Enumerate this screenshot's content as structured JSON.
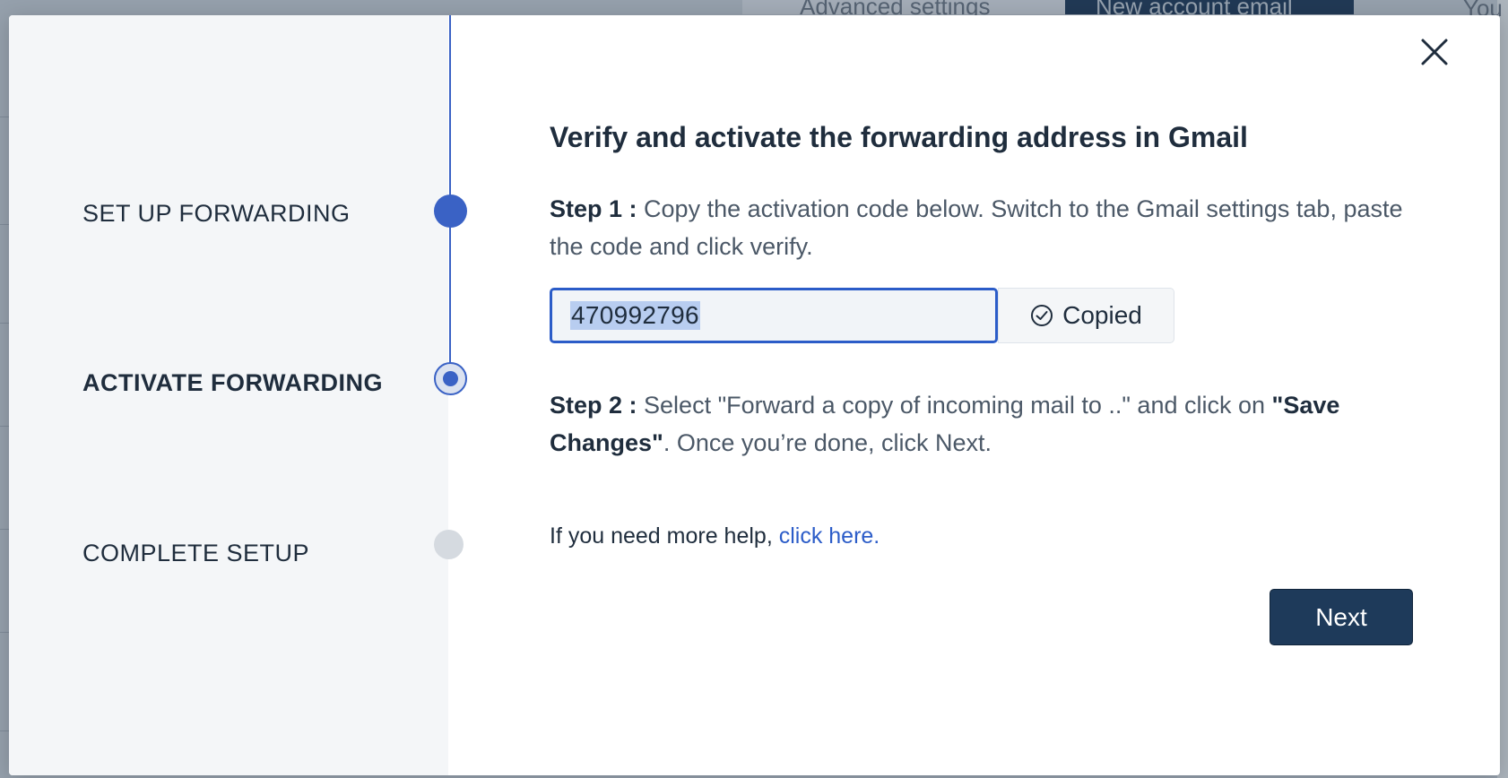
{
  "background": {
    "menu_item": "Advanced settings",
    "button_label": "New account email",
    "right_text": "You"
  },
  "modal": {
    "close_label": "Close",
    "steps": [
      {
        "label": "SET UP FORWARDING",
        "state": "completed"
      },
      {
        "label": "ACTIVATE FORWARDING",
        "state": "active"
      },
      {
        "label": "COMPLETE SETUP",
        "state": "pending"
      }
    ],
    "title": "Verify and activate the forwarding address in Gmail",
    "step1": {
      "prefix": "Step 1 :",
      "text": " Copy the activation code below. Switch to the Gmail settings tab, paste the code and click verify."
    },
    "activation_code": "470992796",
    "copy_button": {
      "label": "Copied",
      "icon": "check-circle-icon"
    },
    "step2": {
      "prefix": "Step 2 :",
      "text_before": " Select \"Forward a copy of incoming mail to ..\" and click on ",
      "emphasis": "\"Save Changes\"",
      "text_after": ". Once you’re done, click Next."
    },
    "help": {
      "text": "If you need more help, ",
      "link": "click here."
    },
    "next_label": "Next"
  },
  "colors": {
    "accent": "#3a62c5",
    "primary_button": "#1e3a5a",
    "link": "#2b5cc8",
    "stepper_bg": "#f4f6f8"
  }
}
